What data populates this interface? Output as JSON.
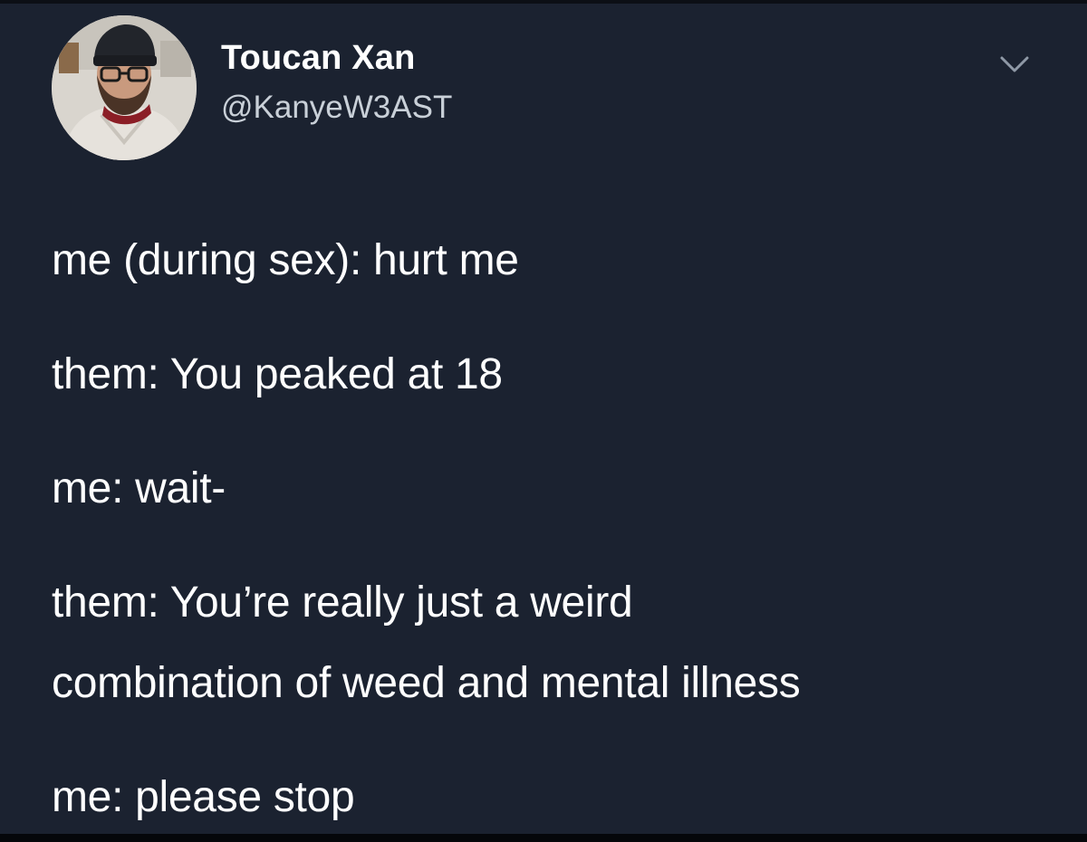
{
  "tweet": {
    "display_name": "Toucan Xan",
    "handle": "@KanyeW3AST",
    "avatar_icon": "profile-photo",
    "menu_icon": "chevron-down-icon",
    "lines": [
      "me (during sex): hurt me",
      "them: You peaked at 18",
      "me: wait-",
      "them: You’re really just a weird",
      "combination of weed and mental illness",
      "me: please stop"
    ]
  },
  "colors": {
    "background": "#1b2230",
    "text": "#ffffff",
    "handle": "#c9d0d8"
  }
}
